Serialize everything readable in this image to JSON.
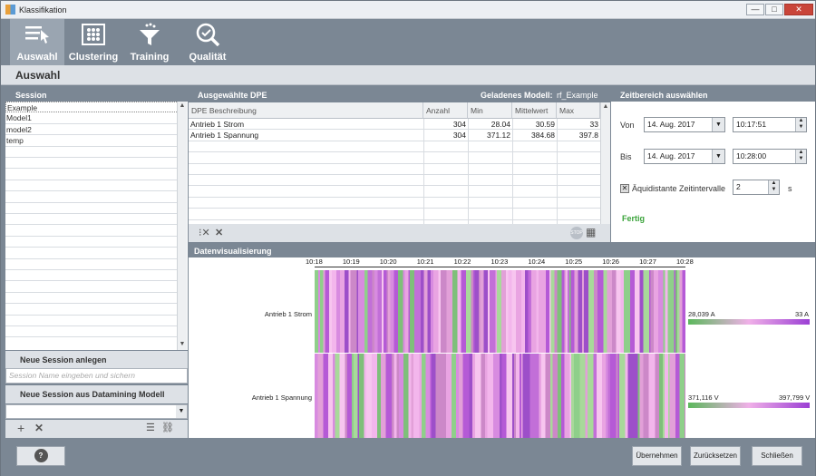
{
  "window": {
    "title": "Klassifikation",
    "buttons": {
      "minimize": "—",
      "maximize": "□",
      "close": "✕"
    }
  },
  "toolbar": {
    "items": [
      {
        "label": "Auswahl",
        "icon": "list-cursor-icon",
        "active": true
      },
      {
        "label": "Clustering",
        "icon": "cluster-icon",
        "active": false
      },
      {
        "label": "Training",
        "icon": "filter-icon",
        "active": false
      },
      {
        "label": "Qualität",
        "icon": "magnifier-check-icon",
        "active": false
      }
    ]
  },
  "section": {
    "title": "Auswahl"
  },
  "session": {
    "header": "Session",
    "items": [
      "Example",
      "Model1",
      "model2",
      "temp"
    ],
    "new_label": "Neue Session anlegen",
    "name_placeholder": "Session Name eingeben und sichern",
    "from_model_label": "Neue Session aus Datamining Modell"
  },
  "dpe": {
    "header": "Ausgewählte DPE",
    "loaded_label": "Geladenes Modell:",
    "loaded_value": "rf_Example",
    "columns": [
      "DPE Beschreibung",
      "Anzahl",
      "Min",
      "Mittelwert",
      "Max"
    ],
    "rows": [
      {
        "desc": "Antrieb 1 Strom",
        "count": "304",
        "min": "28.04",
        "mean": "30.59",
        "max": "33"
      },
      {
        "desc": "Antrieb 1 Spannung",
        "count": "304",
        "min": "371.12",
        "mean": "384.68",
        "max": "397.8"
      }
    ]
  },
  "time": {
    "header": "Zeitbereich auswählen",
    "from_label": "Von",
    "from_date": "14. Aug. 2017",
    "from_time": "10:17:51",
    "to_label": "Bis",
    "to_date": "14. Aug. 2017",
    "to_time": "10:28:00",
    "equidistant_label": "Äquidistante Zeitintervalle",
    "interval_value": "2",
    "interval_unit": "s",
    "status": "Fertig"
  },
  "viz": {
    "header": "Datenvisualisierung",
    "ticks": [
      "10:18",
      "10:19",
      "10:20",
      "10:21",
      "10:22",
      "10:23",
      "10:24",
      "10:25",
      "10:26",
      "10:27",
      "10:28"
    ],
    "signals": [
      {
        "name": "Antrieb 1 Strom",
        "min_label": "28,039 A",
        "max_label": "33 A"
      },
      {
        "name": "Antrieb 1 Spannung",
        "min_label": "371,116 V",
        "max_label": "397,799 V"
      }
    ]
  },
  "footer": {
    "help": "?",
    "apply": "Übernehmen",
    "reset": "Zurücksetzen",
    "close": "Schließen"
  },
  "colors": {
    "low": "#5cb85c",
    "mid": "#f0b0e8",
    "high": "#9b3fd4"
  }
}
